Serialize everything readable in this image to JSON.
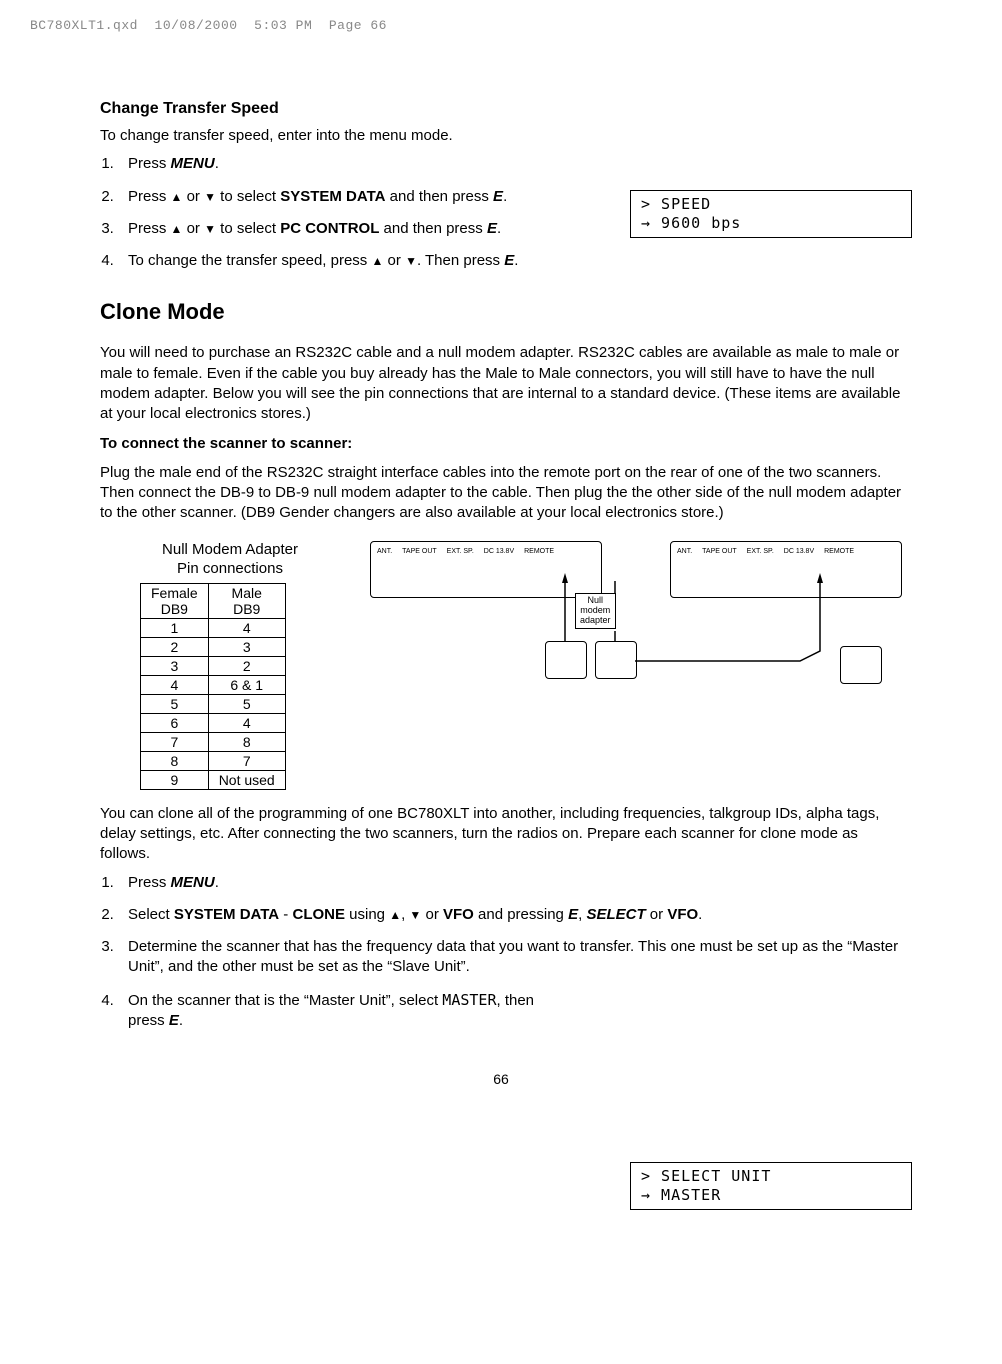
{
  "header": {
    "filename": "BC780XLT1.qxd",
    "date": "10/08/2000",
    "time": "5:03 PM",
    "pageLabel": "Page 66"
  },
  "section1": {
    "title": "Change Transfer Speed",
    "intro": "To change transfer speed, enter into the menu mode.",
    "steps": {
      "s1a": "Press ",
      "s1b": "MENU",
      "s1c": ".",
      "s2a": "Press ",
      "s2b": " or ",
      "s2c": " to select ",
      "s2d": "SYSTEM DATA",
      "s2e": " and then press ",
      "s2f": "E",
      "s2g": ".",
      "s3a": "Press ",
      "s3b": " or ",
      "s3c": " to select ",
      "s3d": "PC CONTROL",
      "s3e": " and then press ",
      "s3f": "E",
      "s3g": ".",
      "s4a": "To change the transfer speed, press ",
      "s4b": " or ",
      "s4c": ". Then press ",
      "s4d": "E",
      "s4e": "."
    },
    "lcd": {
      "line1": "> SPEED",
      "line2": "→ 9600 bps"
    }
  },
  "section2": {
    "title": "Clone Mode",
    "para1": "You will need to purchase an RS232C cable and a null modem adapter. RS232C cables are available as male to male or male to female. Even if the cable you buy already has the Male to Male connectors, you will still have to have the null modem adapter. Below you will see the pin connections that are internal to a standard device. (These items are available at your local electronics stores.)",
    "subTitle": "To connect the scanner to scanner:",
    "para2": "Plug the male end of the RS232C straight interface cables into the remote port on the rear of one of the two scanners. Then connect the DB-9 to DB-9 null modem adapter to the cable. Then plug the the other side of the null modem adapter to the other scanner. (DB9 Gender changers are also available at your local electronics store.)",
    "tableCaption1": "Null Modem Adapter",
    "tableCaption2": "Pin connections",
    "tableHeaders": {
      "left": "Female\nDB9",
      "right": "Male\nDB9"
    },
    "tableRows": [
      {
        "f": "1",
        "m": "4"
      },
      {
        "f": "2",
        "m": "3"
      },
      {
        "f": "3",
        "m": "2"
      },
      {
        "f": "4",
        "m": "6 & 1"
      },
      {
        "f": "5",
        "m": "5"
      },
      {
        "f": "6",
        "m": "4"
      },
      {
        "f": "7",
        "m": "8"
      },
      {
        "f": "8",
        "m": "7"
      },
      {
        "f": "9",
        "m": "Not used"
      }
    ],
    "diagramLabels": {
      "nullModem1": "Null",
      "nullModem2": "modem",
      "nullModem3": "adapter",
      "portAnt": "ANT.",
      "portTape": "TAPE OUT",
      "portExt": "EXT. SP.",
      "portDc": "DC 13.8V",
      "portRemote": "REMOTE"
    },
    "para3": "You can clone all of the programming of one BC780XLT into another, including frequencies, talkgroup IDs, alpha tags, delay settings, etc. After connecting the two scanners, turn the radios on. Prepare each scanner for clone mode as follows.",
    "steps2": {
      "s1a": "Press ",
      "s1b": "MENU",
      "s1c": ".",
      "s2a": "Select ",
      "s2b": "SYSTEM DATA",
      "s2c": " - ",
      "s2d": "CLONE",
      "s2e": " using ",
      "s2f": ", ",
      "s2g": " or ",
      "s2h": "VFO",
      "s2i": " and pressing ",
      "s2j": "E",
      "s2k": ", ",
      "s2l": "SELECT",
      "s2m": " or ",
      "s2n": "VFO",
      "s2o": ".",
      "s3": "Determine the scanner that has the frequency data that you want to transfer. This one must be set up as the “Master Unit”, and the other must be set as the “Slave Unit”.",
      "s4a": "On the scanner that is the “Master Unit”, select ",
      "s4b": "MASTER",
      "s4c": ", then press ",
      "s4d": "E",
      "s4e": "."
    },
    "lcd2": {
      "line1": "> SELECT UNIT",
      "line2": "→ MASTER"
    }
  },
  "pageNumber": "66"
}
